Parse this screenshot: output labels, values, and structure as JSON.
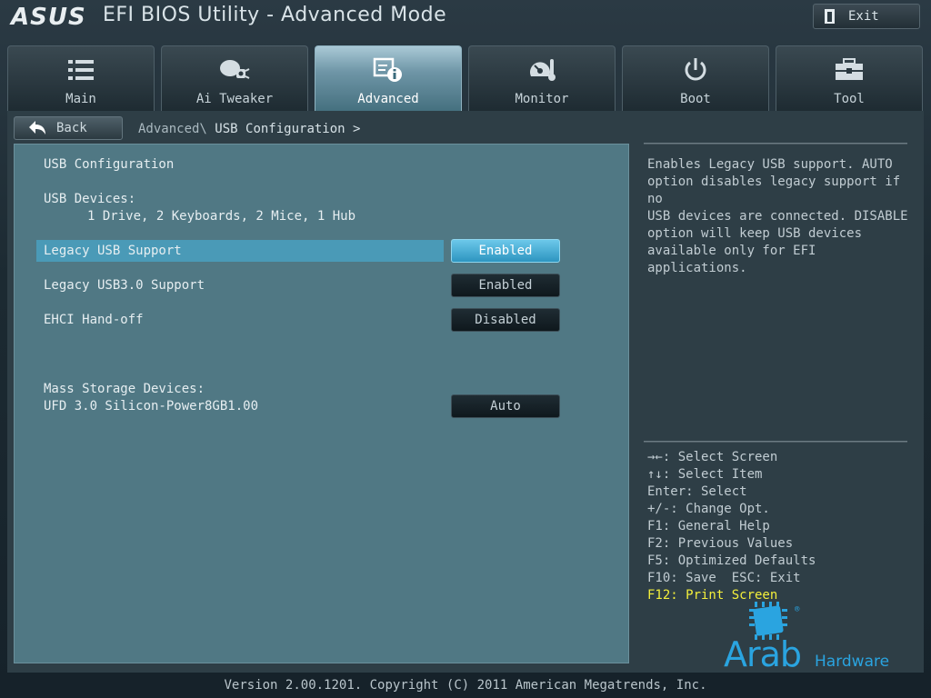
{
  "header": {
    "brand": "ASUS",
    "title": "EFI BIOS Utility - Advanced Mode",
    "exit_label": "Exit"
  },
  "tabs": [
    {
      "label": "Main",
      "icon": "list-icon"
    },
    {
      "label": "Ai Tweaker",
      "icon": "tweaker-icon"
    },
    {
      "label": "Advanced",
      "icon": "advanced-info-icon",
      "active": true
    },
    {
      "label": "Monitor",
      "icon": "monitor-gauge-icon"
    },
    {
      "label": "Boot",
      "icon": "power-icon"
    },
    {
      "label": "Tool",
      "icon": "toolbox-icon"
    }
  ],
  "nav": {
    "back_label": "Back",
    "breadcrumb_parent": "Advanced\\",
    "breadcrumb_current": "USB Configuration >"
  },
  "settings": {
    "section_title": "USB Configuration",
    "usb_devices_label": "USB Devices:",
    "usb_devices_value": "1 Drive, 2 Keyboards, 2 Mice, 1 Hub",
    "items": [
      {
        "label": "Legacy USB Support",
        "value": "Enabled"
      },
      {
        "label": "Legacy USB3.0 Support",
        "value": "Enabled"
      },
      {
        "label": "EHCI Hand-off",
        "value": "Disabled"
      }
    ],
    "mass_storage_label": "Mass Storage Devices:",
    "mass_storage_device": "UFD 3.0 Silicon-Power8GB1.00",
    "mass_storage_value": "Auto"
  },
  "help_text": "Enables Legacy USB support. AUTO\noption disables legacy support if no\nUSB devices are connected. DISABLE\noption will keep USB devices\navailable only for EFI applications.",
  "key_help": [
    "→←: Select Screen",
    "↑↓: Select Item",
    "Enter: Select",
    "+/-: Change Opt.",
    "F1: General Help",
    "F2: Previous Values",
    "F5: Optimized Defaults",
    "F10: Save  ESC: Exit",
    "F12: Print Screen"
  ],
  "watermark": {
    "text": "Arab",
    "sub": "Hardware",
    "reg": "®"
  },
  "footer": "Version 2.00.1201. Copyright (C) 2011 American Megatrends, Inc.",
  "colors": {
    "accent": "#4a9ab7",
    "active_value": "#2d95c0",
    "hotkey": "#f3ef3b",
    "logo": "#2aa4e0"
  }
}
